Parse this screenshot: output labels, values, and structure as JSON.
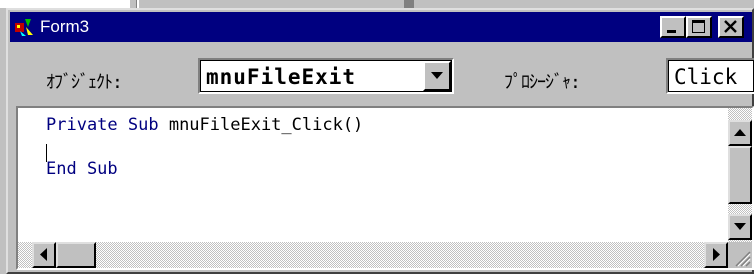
{
  "window": {
    "title": "Form3",
    "controls": {
      "minimize": "minimize",
      "maximize": "maximize",
      "close": "close"
    }
  },
  "object_selector": {
    "label": "ｵﾌﾞｼﾞｪｸﾄ:",
    "value": "mnuFileExit"
  },
  "procedure_selector": {
    "label": "ﾌﾟﾛｼｰｼﾞｬ:",
    "value": "Click"
  },
  "code": {
    "line1_keyword": "Private Sub",
    "line1_name": " mnuFileExit_Click()",
    "line3": "End Sub"
  },
  "icons": {
    "app": "vb-form-icon",
    "combo_arrow": "triangle-down",
    "scroll_up": "triangle-up",
    "scroll_down": "triangle-down",
    "scroll_left": "triangle-left",
    "scroll_right": "triangle-right"
  },
  "colors": {
    "titlebar": "#000080",
    "keyword": "#000080",
    "face": "#c0c0c0"
  }
}
